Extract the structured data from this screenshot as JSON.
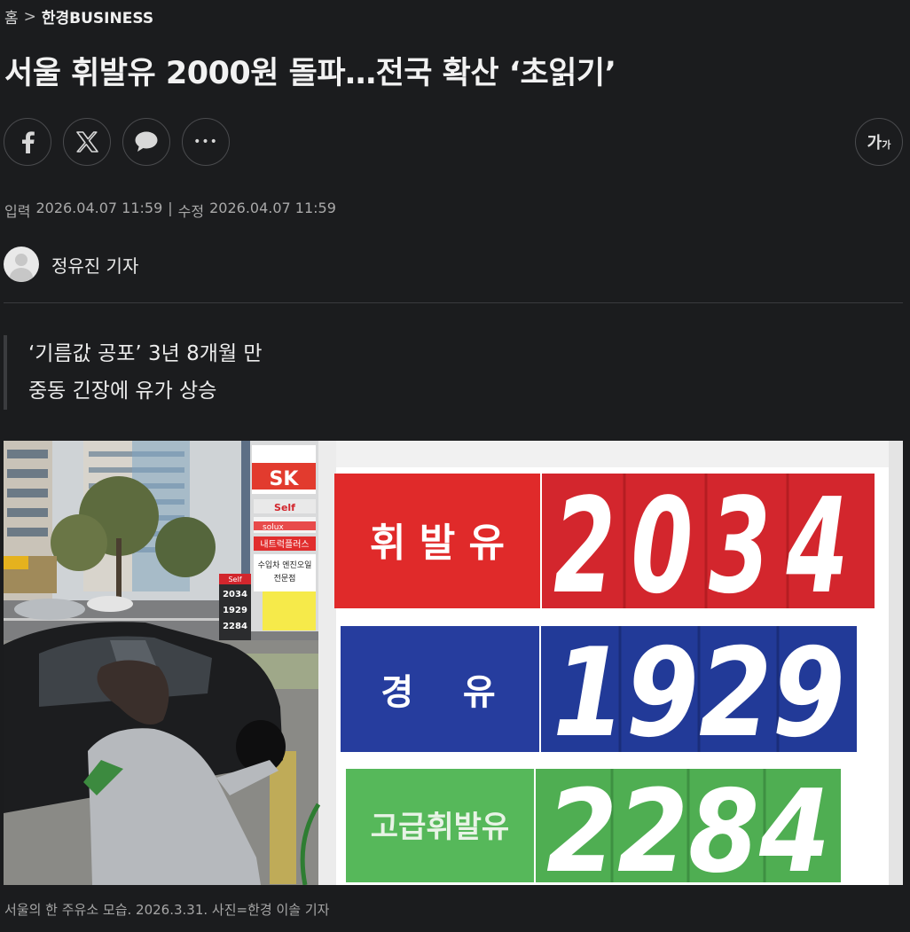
{
  "breadcrumb": {
    "home": "홈",
    "separator": ">",
    "section": "한경BUSINESS"
  },
  "article": {
    "title": "서울 휘발유 2000원 돌파…전국 확산 ‘초읽기’",
    "dates": {
      "input_label": "입력",
      "input_value": "2026.04.07 11:59",
      "separator": "|",
      "modified_label": "수정",
      "modified_value": "2026.04.07 11:59"
    },
    "author": "정유진 기자",
    "summary": [
      "‘기름값 공포’ 3년 8개월 만",
      "중동 긴장에 유가 상승"
    ],
    "caption": "서울의 한 주유소 모습. 2026.3.31. 사진=한경 이솔 기자"
  },
  "share": {
    "icons": [
      "facebook-icon",
      "x-icon",
      "comment-icon",
      "more-icon"
    ],
    "more_glyph": "•••"
  },
  "font_size": {
    "big": "가",
    "small": "가"
  },
  "photo": {
    "board": [
      {
        "label": "휘 발 유",
        "price": "2034",
        "label_color": "#e02a2a",
        "digit_color": "#d3262d"
      },
      {
        "label": "경    유",
        "price": "1929",
        "label_color": "#263d9e",
        "digit_color": "#223a98"
      },
      {
        "label": "고급휘발유",
        "price": "2284",
        "label_color": "#56b85a",
        "digit_color": "#4fae52"
      }
    ],
    "background_signs": {
      "brand": "SK",
      "self": "Self",
      "small_board_self": "Self",
      "small_board_prices": [
        "2034",
        "1929",
        "2284"
      ],
      "sign_lines": [
        "solux",
        "내트럭플러스",
        "수입차 엔진오일",
        "전문점"
      ]
    }
  }
}
